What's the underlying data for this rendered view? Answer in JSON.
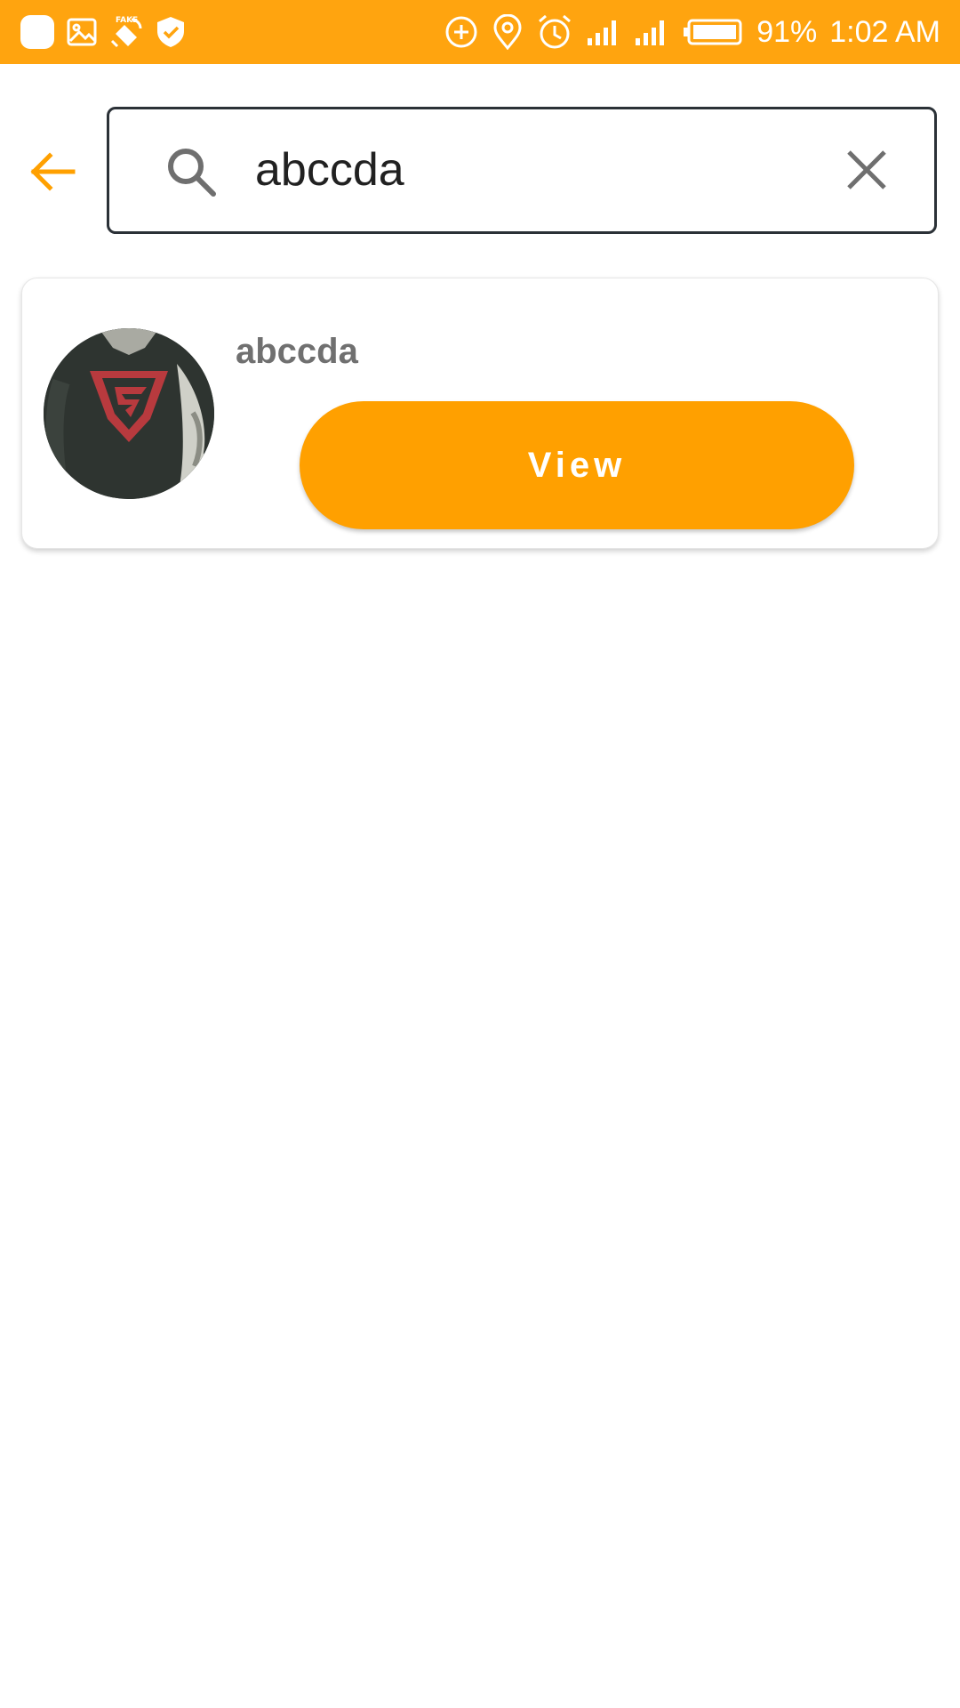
{
  "status_bar": {
    "battery_percent": "91%",
    "time": "1:02 AM",
    "left_icons": [
      "app-notification-icon",
      "image-icon",
      "fake-gps-icon",
      "shield-check-icon"
    ],
    "right_icons": [
      "data-saver-icon",
      "location-icon",
      "alarm-icon",
      "signal-icon",
      "signal-icon",
      "battery-icon"
    ],
    "background_color": "#FFA40F"
  },
  "search": {
    "query": "abccda",
    "back_icon": "arrow-back-icon",
    "search_icon": "search-icon",
    "clear_icon": "close-icon",
    "accent_color": "#FFA000"
  },
  "results": [
    {
      "username": "abccda",
      "avatar": "superman-shirt-avatar",
      "button_label": "View"
    }
  ]
}
